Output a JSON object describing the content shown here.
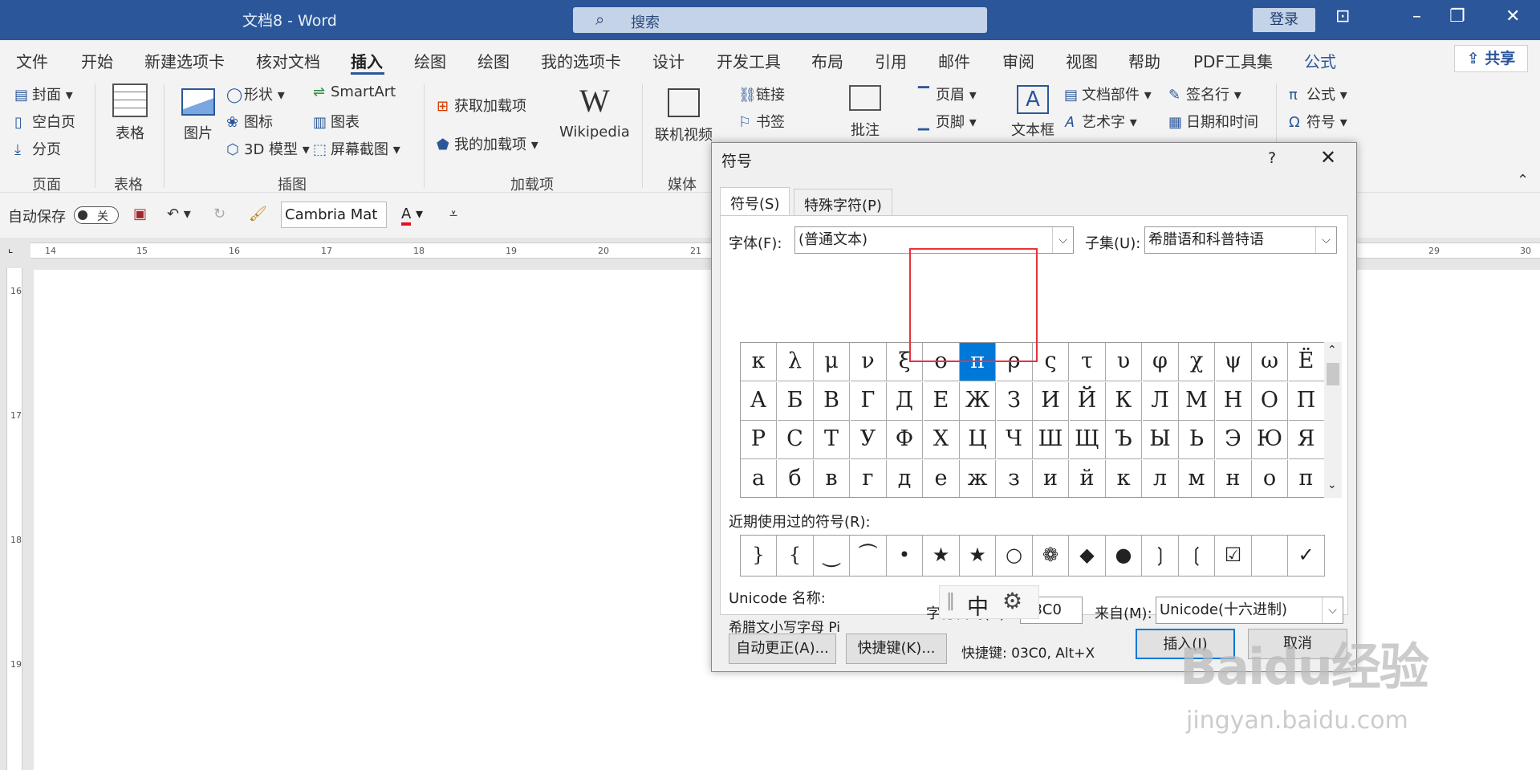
{
  "titlebar": {
    "title": "文档8 - Word",
    "search_icon": "search-icon",
    "search_placeholder": "搜索",
    "login": "登录"
  },
  "menu": {
    "file": "文件",
    "home": "开始",
    "new_tab": "新建选项卡",
    "review_doc": "核对文档",
    "insert": "插入",
    "draw1": "绘图",
    "draw2": "绘图",
    "my_tab": "我的选项卡",
    "design": "设计",
    "dev": "开发工具",
    "layout": "布局",
    "refs": "引用",
    "mail": "邮件",
    "review": "审阅",
    "view": "视图",
    "help": "帮助",
    "pdf": "PDF工具集",
    "formula": "公式",
    "share": "共享"
  },
  "ribbon": {
    "cover": "封面",
    "blank": "空白页",
    "pagebreak": "分页",
    "table": "表格",
    "picture": "图片",
    "shapes": "形状",
    "icons": "图标",
    "model3d": "3D 模型",
    "smartart": "SmartArt",
    "chart": "图表",
    "screenshot": "屏幕截图",
    "get_addins": "获取加载项",
    "my_addins": "我的加载项",
    "wikipedia": "Wikipedia",
    "online_video": "联机视频",
    "link": "链接",
    "bookmark": "书签",
    "comment": "批注",
    "header": "页眉",
    "footer": "页脚",
    "textbox": "文本框",
    "docparts": "文档部件",
    "wordart": "艺术字",
    "signature": "签名行",
    "datetime": "日期和时间",
    "equation": "公式",
    "symbol": "符号",
    "groups": {
      "pages": "页面",
      "tables": "表格",
      "illustrations": "插图",
      "addins": "加载项",
      "media": "媒体"
    }
  },
  "qat": {
    "autosave": "自动保存",
    "toggle_state": "关",
    "font": "Cambria Mat"
  },
  "ruler": {
    "h": [
      "14",
      "15",
      "16",
      "17",
      "18",
      "19",
      "20",
      "21",
      "29",
      "30"
    ],
    "v": [
      "16",
      "17",
      "18",
      "19"
    ]
  },
  "dialog": {
    "title": "符号",
    "help": "?",
    "close": "✕",
    "tab_symbols": "符号(S)",
    "tab_special": "特殊字符(P)",
    "font_label": "字体(F):",
    "font_value": "(普通文本)",
    "subset_label": "子集(U):",
    "subset_value": "希腊语和科普特语",
    "grid": [
      [
        "κ",
        "λ",
        "μ",
        "ν",
        "ξ",
        "ο",
        "π",
        "ρ",
        "ς",
        "τ",
        "υ",
        "φ",
        "χ",
        "ψ",
        "ω",
        "Ë"
      ],
      [
        "А",
        "Б",
        "В",
        "Г",
        "Д",
        "Е",
        "Ж",
        "З",
        "И",
        "Й",
        "К",
        "Л",
        "М",
        "Н",
        "О",
        "П"
      ],
      [
        "Р",
        "С",
        "Т",
        "У",
        "Ф",
        "Х",
        "Ц",
        "Ч",
        "Ш",
        "Щ",
        "Ъ",
        "Ы",
        "Ь",
        "Э",
        "Ю",
        "Я"
      ],
      [
        "а",
        "б",
        "в",
        "г",
        "д",
        "е",
        "ж",
        "з",
        "и",
        "й",
        "к",
        "л",
        "м",
        "н",
        "о",
        "п"
      ]
    ],
    "selected": "π",
    "recent_label": "近期使用过的符号(R):",
    "recent": [
      "}",
      "{",
      "⏝",
      "⏜",
      "•",
      "★",
      "★",
      "○",
      "❁",
      "◆",
      "●",
      "❳",
      "❲",
      "☑",
      " ",
      "✓"
    ],
    "unicode_name_label": "Unicode 名称:",
    "unicode_name": "希腊文小写字母 Pi",
    "code_label": "字符代码(C):",
    "code_value": "03C0",
    "from_label": "来自(M):",
    "from_value": "Unicode(十六进制)",
    "autocorrect": "自动更正(A)...",
    "shortcut_key": "快捷键(K)...",
    "shortcut_text": "快捷键: 03C0, Alt+X",
    "insert": "插入(I)",
    "cancel": "取消"
  },
  "ime": {
    "mode": "中",
    "settings_icon": "gear-icon"
  },
  "watermark": {
    "brand": "Baidu经验",
    "url": "jingyan.baidu.com"
  }
}
